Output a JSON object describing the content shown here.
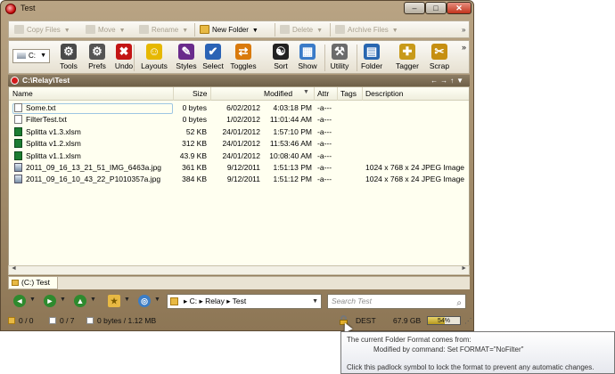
{
  "window": {
    "title": "Test",
    "minimize_glyph": "–",
    "maximize_glyph": "□",
    "close_glyph": "✕"
  },
  "toolbar1": {
    "copy_files": "Copy Files",
    "move": "Move",
    "rename": "Rename",
    "new_folder": "New Folder",
    "delete": "Delete",
    "archive_files": "Archive Files",
    "overflow": "»"
  },
  "toolbar2": {
    "drive": "C:",
    "items": [
      {
        "label": "Tools",
        "icon": "gear-icon",
        "color": "#4a4a4a",
        "glyph": "⚙"
      },
      {
        "label": "Prefs",
        "icon": "gear-icon",
        "color": "#555555",
        "glyph": "⚙"
      },
      {
        "label": "Undo",
        "icon": "x-icon",
        "color": "#c31515",
        "glyph": "✖"
      },
      {
        "label": "Layouts",
        "icon": "smiley-icon",
        "color": "#e6b800",
        "glyph": "☺"
      },
      {
        "label": "Styles",
        "icon": "styles-icon",
        "color": "#6a2c8c",
        "glyph": "✎"
      },
      {
        "label": "Select",
        "icon": "checkbox-icon",
        "color": "#2b63b5",
        "glyph": "✔"
      },
      {
        "label": "Toggles",
        "icon": "toggles-icon",
        "color": "#d97a0d",
        "glyph": "⇄"
      },
      {
        "label": "Sort",
        "icon": "yin-yang-icon",
        "color": "#222222",
        "glyph": "☯"
      },
      {
        "label": "Show",
        "icon": "grid-icon",
        "color": "#3a7bc8",
        "glyph": "▦"
      },
      {
        "label": "Utility",
        "icon": "hammer-icon",
        "color": "#6b6b6b",
        "glyph": "⚒"
      },
      {
        "label": "Folder",
        "icon": "folder-icon",
        "color": "#2967b0",
        "glyph": "▤"
      },
      {
        "label": "Tagger",
        "icon": "tag-icon",
        "color": "#c89a1a",
        "glyph": "✚"
      },
      {
        "label": "Scrap",
        "icon": "scrap-icon",
        "color": "#c68f12",
        "glyph": "✂"
      }
    ],
    "overflow": "»"
  },
  "pathbar": {
    "path": "C:\\Relay\\Test",
    "nav": "←→↑▼"
  },
  "columns": {
    "name": "Name",
    "size": "Size",
    "modified": "Modified",
    "attr": "Attr",
    "tags": "Tags",
    "description": "Description"
  },
  "files": [
    {
      "name": "Some.txt",
      "size": "0 bytes",
      "date": "6/02/2012",
      "time": "4:03:18 PM",
      "attr": "-a---",
      "desc": "",
      "type": "txt"
    },
    {
      "name": "FilterTest.txt",
      "size": "0 bytes",
      "date": "1/02/2012",
      "time": "11:01:44 AM",
      "attr": "-a---",
      "desc": "",
      "type": "txt"
    },
    {
      "name": "Splitta v1.3.xlsm",
      "size": "52 KB",
      "date": "24/01/2012",
      "time": "1:57:10 PM",
      "attr": "-a---",
      "desc": "",
      "type": "xl"
    },
    {
      "name": "Splitta v1.2.xlsm",
      "size": "312 KB",
      "date": "24/01/2012",
      "time": "11:53:46 AM",
      "attr": "-a---",
      "desc": "",
      "type": "xl"
    },
    {
      "name": "Splitta v1.1.xlsm",
      "size": "43.9 KB",
      "date": "24/01/2012",
      "time": "10:08:40 AM",
      "attr": "-a---",
      "desc": "",
      "type": "xl"
    },
    {
      "name": "2011_09_16_13_21_51_IMG_6463a.jpg",
      "size": "361 KB",
      "date": "9/12/2011",
      "time": "1:51:13 PM",
      "attr": "-a---",
      "desc": "1024 x 768 x 24 JPEG Image",
      "type": "img"
    },
    {
      "name": "2011_09_16_10_43_22_P1010357a.jpg",
      "size": "384 KB",
      "date": "9/12/2011",
      "time": "1:51:12 PM",
      "attr": "-a---",
      "desc": "1024 x 768 x 24 JPEG Image",
      "type": "img"
    }
  ],
  "folder_tab": "(C:) Test",
  "addressbar": {
    "segments": "▸ C: ▸ Relay ▸ Test",
    "search_placeholder": "Search Test"
  },
  "status": {
    "folders": "0 / 0",
    "files": "0 / 7",
    "size": "0 bytes / 1.12 MB",
    "dest": "DEST",
    "free": "67.9 GB",
    "percent_text": "54%",
    "percent_value": 0.54
  },
  "tooltip": {
    "line1": "The current Folder Format comes from:",
    "line2": "Modified by command: Set FORMAT=\"NoFilter\"",
    "line3": "Click this padlock symbol to lock the format to prevent any automatic changes."
  }
}
